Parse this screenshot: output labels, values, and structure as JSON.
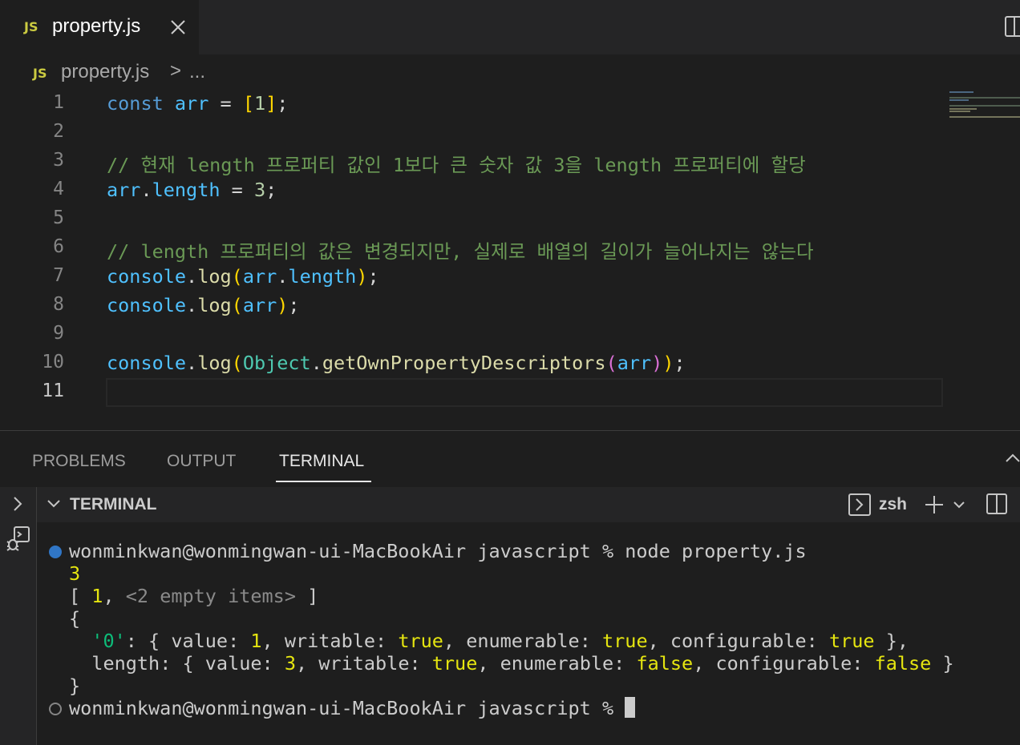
{
  "tab": {
    "badge": "JS",
    "filename": "property.js"
  },
  "breadcrumb": {
    "badge": "JS",
    "filename": "property.js",
    "separator": ">",
    "more": "..."
  },
  "editor": {
    "line_numbers": [
      "1",
      "2",
      "3",
      "4",
      "5",
      "6",
      "7",
      "8",
      "9",
      "10",
      "11"
    ],
    "active_line": "11",
    "lines": [
      "const arr = [1];",
      "",
      "// 현재 length 프로퍼티 값인 1보다 큰 숫자 값 3을 length 프로퍼티에 할당",
      "arr.length = 3;",
      "",
      "// length 프로퍼티의 값은 변경되지만, 실제로 배열의 길이가 늘어나지는 않는다",
      "console.log(arr.length);",
      "console.log(arr);",
      "",
      "console.log(Object.getOwnPropertyDescriptors(arr));",
      ""
    ]
  },
  "panel": {
    "tabs": [
      "PROBLEMS",
      "OUTPUT",
      "TERMINAL"
    ],
    "active_tab": "TERMINAL",
    "header_title": "TERMINAL",
    "shell": "zsh"
  },
  "terminal": {
    "prompt1": "wonminkwan@wonmingwan-ui-MacBookAir javascript % node property.js",
    "out_length": "3",
    "out_arr_open": "[ ",
    "out_arr_one": "1",
    "out_arr_comma": ", ",
    "out_arr_empty": "<2 empty items>",
    "out_arr_close": " ]",
    "brace_open": "{",
    "brace_close": "}",
    "prop0": {
      "key": "'0'",
      "value": "1",
      "writable": "true",
      "enumerable": "true",
      "configurable": "true"
    },
    "propLength": {
      "key": "length",
      "value": "3",
      "writable": "true",
      "enumerable": "false",
      "configurable": "false"
    },
    "prompt2": "wonminkwan@wonmingwan-ui-MacBookAir javascript % "
  },
  "colors": {
    "js_badge": "#cbcb41",
    "keyword": "#569cd6",
    "comment": "#6a9955",
    "terminal_number": "#e5e510",
    "terminal_string": "#0dbc79"
  }
}
